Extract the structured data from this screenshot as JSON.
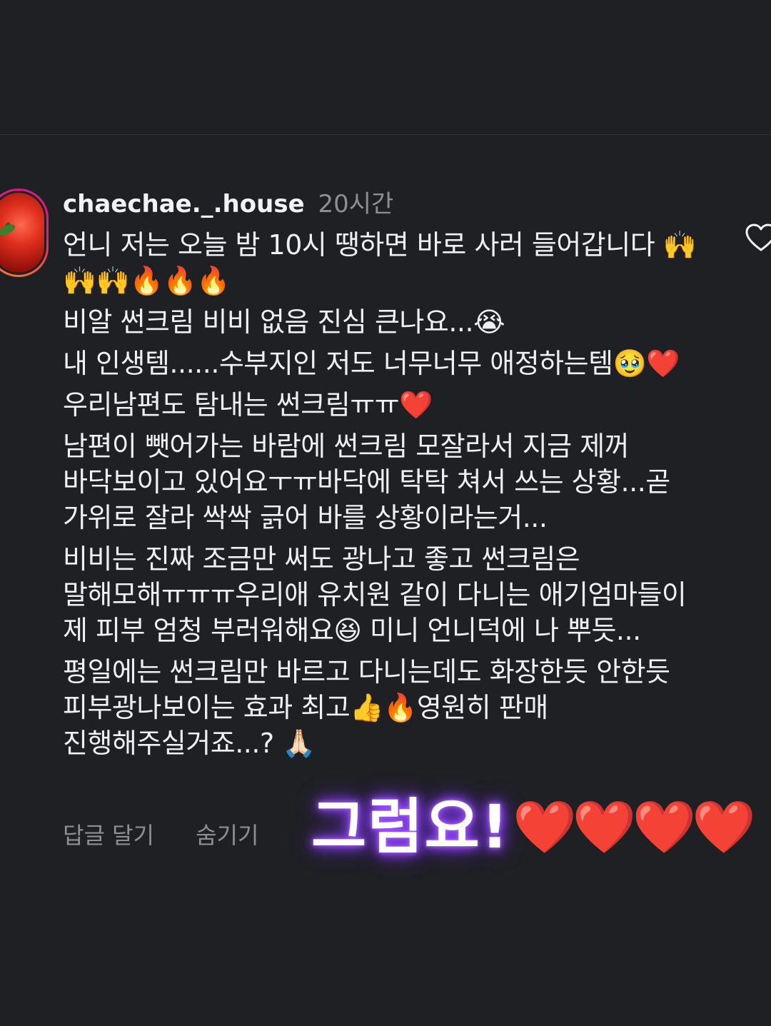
{
  "comment": {
    "username": "chaechae._.house",
    "time": "20시간",
    "paragraphs": [
      "언니 저는 오늘 밤 10시 땡하면 바로 사러 들어갑니다 🙌🙌🙌🔥🔥🔥",
      "비알 썬크림 비비 없음 진심 큰나요...😭",
      "내 인생템......수부지인 저도 너무너무 애정하는템🥹❤️",
      "우리남편도 탐내는 썬크림ㅠㅠ❤️",
      "남편이 뺏어가는 바람에 썬크림 모잘라서 지금 제꺼 바닥보이고 있어요ㅜㅠ바닥에 탁탁 쳐서 쓰는 상황...곧 가위로 잘라 싹싹 긁어 바를 상황이라는거...",
      "비비는 진짜 조금만 써도 광나고 좋고 썬크림은 말해모해ㅠㅠㅠ우리애 유치원 같이 다니는 애기엄마들이 제 피부 엄청 부러워해요😆 미니 언니덕에 나 뿌듯...",
      "평일에는 썬크림만 바르고 다니는데도 화장한듯 안한듯 피부광나보이는 효과 최고👍🔥영원히 판매 진행해주실거죠...? 🙏🏻"
    ],
    "reply_label": "답글 달기",
    "hide_label": "숨기기"
  },
  "overlay": {
    "text": "그럼요!",
    "hearts": "❤️❤️❤️❤️"
  },
  "icons": {
    "like": "heart-outline-icon",
    "avatar": "tomato-avatar"
  },
  "colors": {
    "background": "#1f2024",
    "text": "#f2f2f4",
    "muted": "#8e8f95",
    "glow": "#9b4dff",
    "heart": "#e01424"
  }
}
